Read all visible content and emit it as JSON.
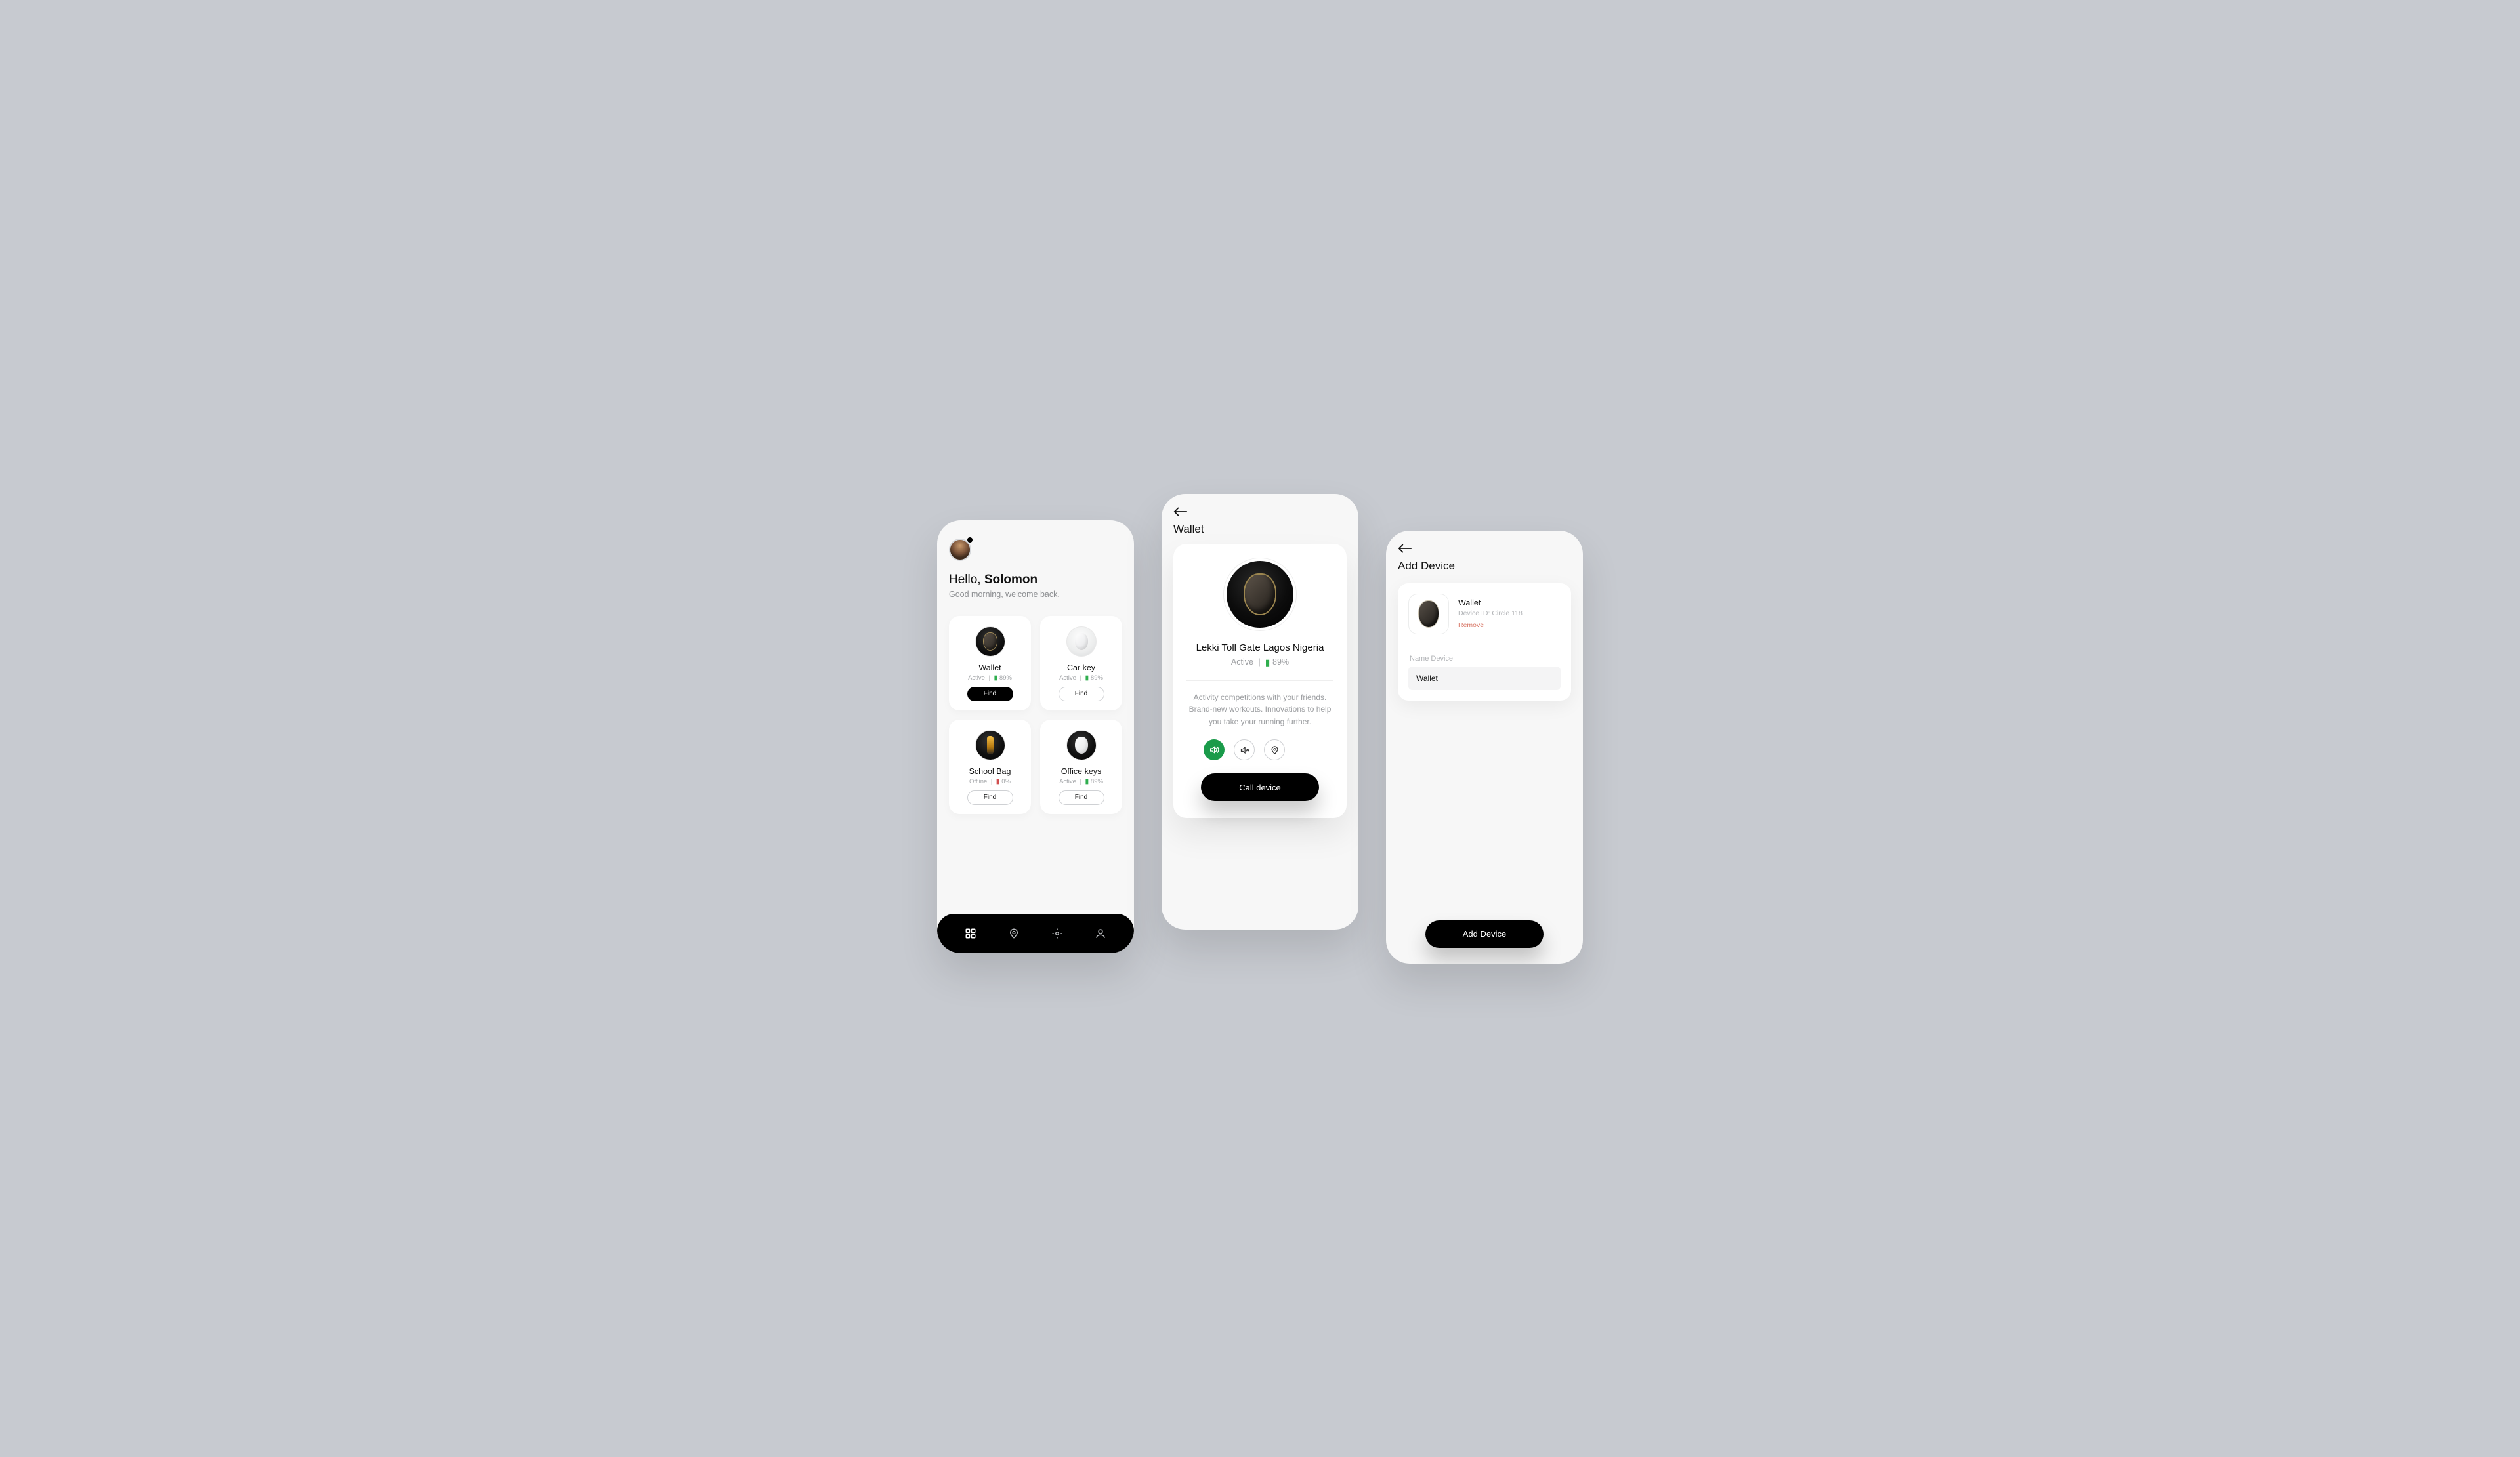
{
  "home": {
    "greeting_prefix": "Hello, ",
    "greeting_name": "Solomon",
    "subtitle": "Good morning, welcome back.",
    "devices": [
      {
        "name": "Wallet",
        "status": "Active",
        "battery": "89%",
        "battery_ok": true,
        "find": "Find",
        "primary": true,
        "thumb": "dark",
        "shape": "drop"
      },
      {
        "name": "Car key",
        "status": "Active",
        "battery": "89%",
        "battery_ok": true,
        "find": "Find",
        "primary": false,
        "thumb": "light",
        "shape": "drop"
      },
      {
        "name": "School Bag",
        "status": "Offline",
        "battery": "0%",
        "battery_ok": false,
        "find": "Find",
        "primary": false,
        "thumb": "dark",
        "shape": "stick"
      },
      {
        "name": "Office keys",
        "status": "Active",
        "battery": "89%",
        "battery_ok": true,
        "find": "Find",
        "primary": false,
        "thumb": "dark",
        "shape": "drop-light"
      }
    ]
  },
  "detail": {
    "title": "Wallet",
    "location": "Lekki Toll Gate Lagos Nigeria",
    "status": "Active",
    "battery": "89%",
    "description": "Activity competitions with your friends. Brand-new workouts. Innovations to help you take your running further.",
    "call_label": "Call device"
  },
  "add": {
    "title": "Add Device",
    "device_name": "Wallet",
    "device_id": "Device ID: Circle 118",
    "remove_label": "Remove",
    "field_label": "Name Device",
    "field_value": "Wallet",
    "add_label": "Add Device"
  }
}
